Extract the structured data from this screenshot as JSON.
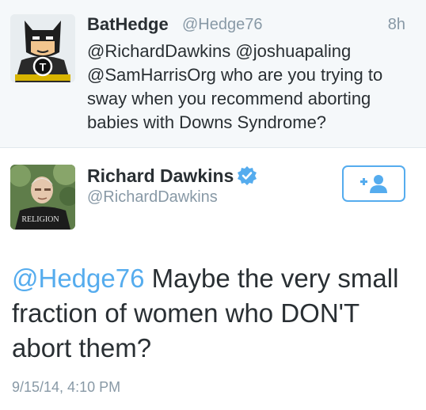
{
  "reply": {
    "name": "BatHedge",
    "handle": "@Hedge76",
    "time": "8h",
    "text": "@RichardDawkins @joshuapaling @SamHarrisOrg who are you trying to sway when you recommend aborting babies with Downs Syndrome?",
    "avatar_badge_letter": "T"
  },
  "tweet": {
    "name": "Richard Dawkins",
    "handle": "@RichardDawkins",
    "mention": "@Hedge76",
    "text": " Maybe the very small fraction of women who DON'T abort them?",
    "timestamp": "9/15/14, 4:10 PM",
    "avatar_shirt_text": "RELIGION",
    "verified_icon": "verified-badge-icon",
    "follow_icon": "add-user-icon"
  },
  "colors": {
    "accent": "#55acee",
    "muted": "#8899a6",
    "text": "#292f33",
    "reply_background": "#f5f8fa"
  }
}
